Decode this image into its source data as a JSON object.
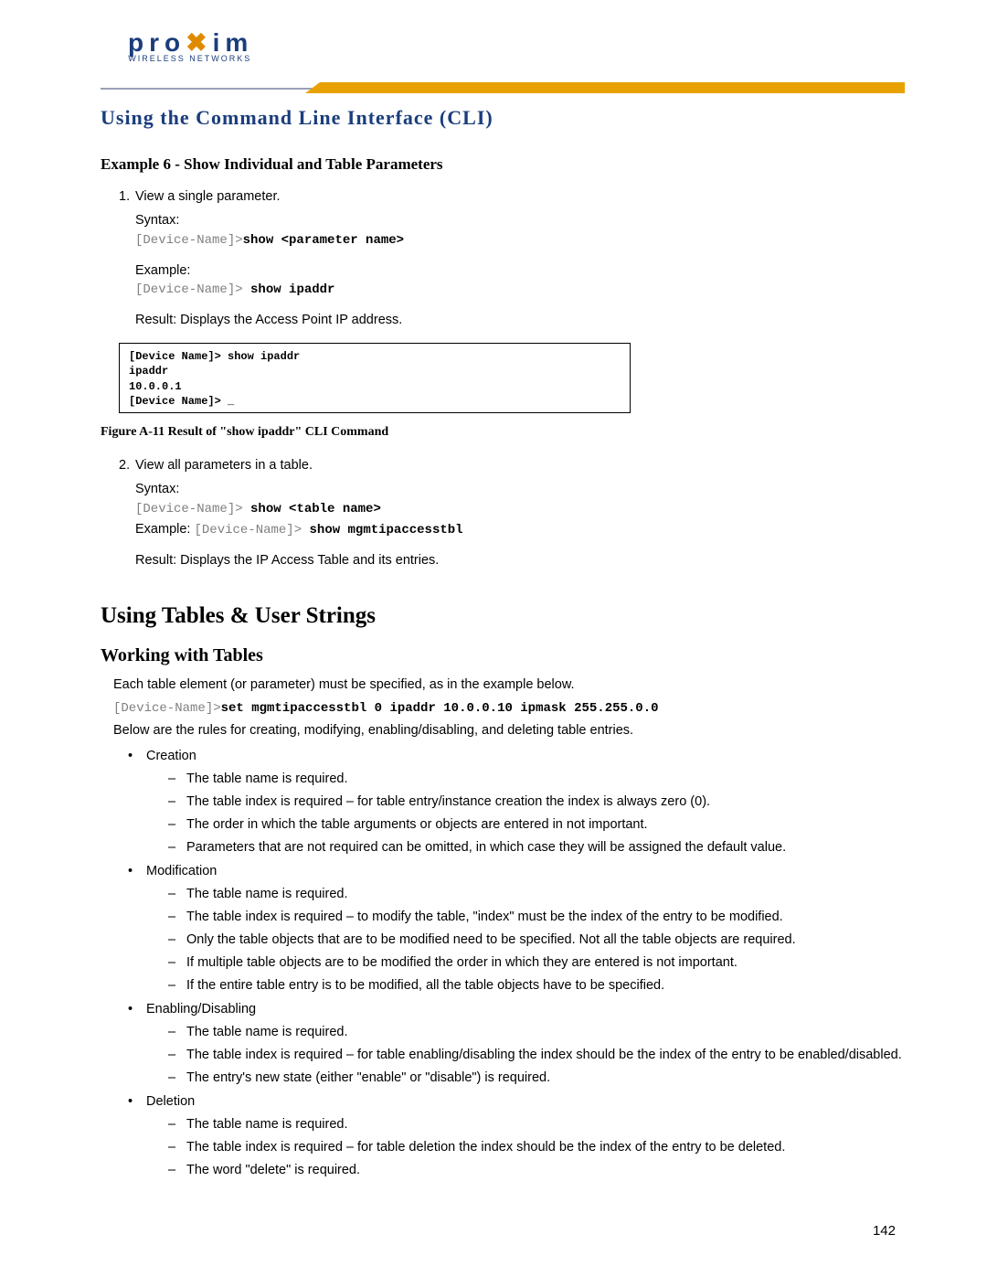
{
  "logo": {
    "brand_pre": "pro",
    "brand_x": "x",
    "brand_post": "im",
    "sub": "WIRELESS NETWORKS"
  },
  "chapter_title": "Using the Command Line Interface (CLI)",
  "example6": {
    "heading": "Example 6 - Show Individual and Table Parameters",
    "item1": {
      "num": "1.",
      "text": "View a single parameter.",
      "syntax_label": "Syntax:",
      "syntax_prompt": "[Device-Name]>",
      "syntax_cmd": "show <parameter name>",
      "example_label": "Example:",
      "example_prompt": "[Device-Name]> ",
      "example_cmd": "show ipaddr",
      "result": "Result: Displays the Access Point IP address."
    },
    "cli_box": {
      "l1": "[Device Name]> show ipaddr",
      "l2": "ipaddr",
      "l3": "10.0.0.1",
      "l4": "[Device Name]> _"
    },
    "figure_caption": "Figure A-11   Result of \"show ipaddr\" CLI Command",
    "item2": {
      "num": "2.",
      "text": "View all parameters in a table.",
      "syntax_label": "Syntax:",
      "syntax_prompt": "[Device-Name]> ",
      "syntax_cmd": "show <table name>",
      "example_label": "Example:",
      "example_prompt": "[Device-Name]> ",
      "example_cmd": "show mgmtipaccesstbl",
      "result": "Result: Displays the IP Access Table and its entries."
    }
  },
  "section2": {
    "h1": "Using Tables & User Strings",
    "h2": "Working with Tables",
    "p1": "Each table element (or parameter) must be specified, as in the example below.",
    "code_prompt": "[Device-Name]>",
    "code_cmd": "set mgmtipaccesstbl 0 ipaddr 10.0.0.10 ipmask 255.255.0.0",
    "p2": "Below are the rules for creating, modifying, enabling/disabling, and deleting table entries.",
    "groups": [
      {
        "title": "Creation",
        "items": [
          "The table name is required.",
          "The table index is required – for table entry/instance creation the index is always zero (0).",
          "The order in which the table arguments or objects are entered in not important.",
          "Parameters that are not required can be omitted, in which case they will be assigned the default value."
        ]
      },
      {
        "title": "Modification",
        "items": [
          "The table name is required.",
          "The table index is required – to modify the table, \"index\" must be the index of the entry to be modified.",
          "Only the table objects that are to be modified need to be specified. Not all the table objects are required.",
          "If multiple table objects are to be modified the order in which they are entered is not important.",
          "If the entire table entry is to be modified, all the table objects have to be specified."
        ]
      },
      {
        "title": "Enabling/Disabling",
        "items": [
          "The table name is required.",
          "The table index is required – for table enabling/disabling the index should be the index of the entry to be enabled/disabled.",
          "The entry's new state (either \"enable\" or \"disable\") is required."
        ]
      },
      {
        "title": "Deletion",
        "items": [
          "The table name is required.",
          "The table index is required – for table deletion the index should be the index of the entry to be deleted.",
          "The word \"delete\" is required."
        ]
      }
    ]
  },
  "page_number": "142"
}
